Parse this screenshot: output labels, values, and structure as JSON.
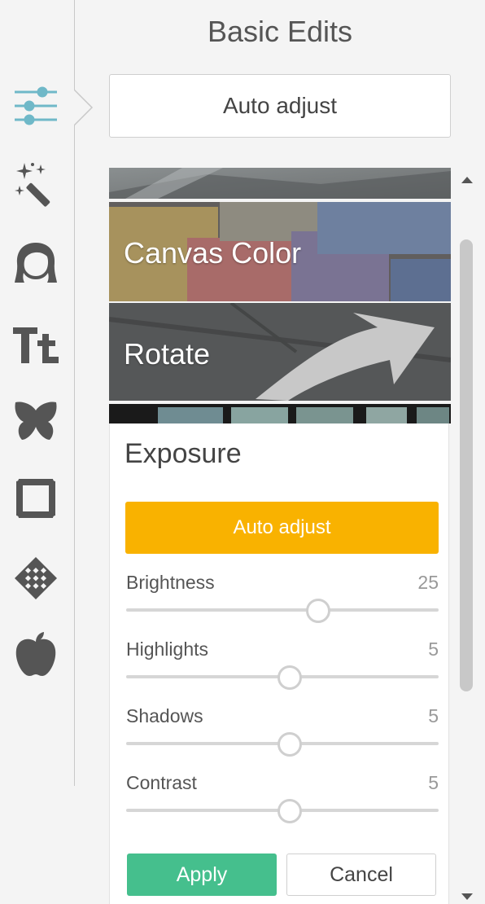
{
  "sidebar": {
    "tools": [
      {
        "name": "sliders-icon",
        "active": true
      },
      {
        "name": "magic-wand-icon"
      },
      {
        "name": "face-icon"
      },
      {
        "name": "text-icon",
        "glyph": "Tt"
      },
      {
        "name": "butterfly-icon"
      },
      {
        "name": "frame-icon"
      },
      {
        "name": "texture-icon"
      },
      {
        "name": "apple-icon"
      }
    ],
    "active_color": "#6fb8c8",
    "icon_color": "#555555"
  },
  "panel": {
    "title": "Basic Edits",
    "auto_adjust_label": "Auto adjust"
  },
  "banners": {
    "canvas_color_label": "Canvas Color",
    "rotate_label": "Rotate"
  },
  "exposure": {
    "title": "Exposure",
    "auto_adjust_label": "Auto adjust",
    "accent_color": "#f9b200",
    "sliders": [
      {
        "label": "Brightness",
        "value": "25",
        "fraction": 0.615
      },
      {
        "label": "Highlights",
        "value": "5",
        "fraction": 0.523
      },
      {
        "label": "Shadows",
        "value": "5",
        "fraction": 0.523
      },
      {
        "label": "Contrast",
        "value": "5",
        "fraction": 0.523
      }
    ],
    "apply_label": "Apply",
    "cancel_label": "Cancel",
    "apply_color": "#45bf8d"
  },
  "scrollbar": {
    "position_fraction": 0.1
  }
}
